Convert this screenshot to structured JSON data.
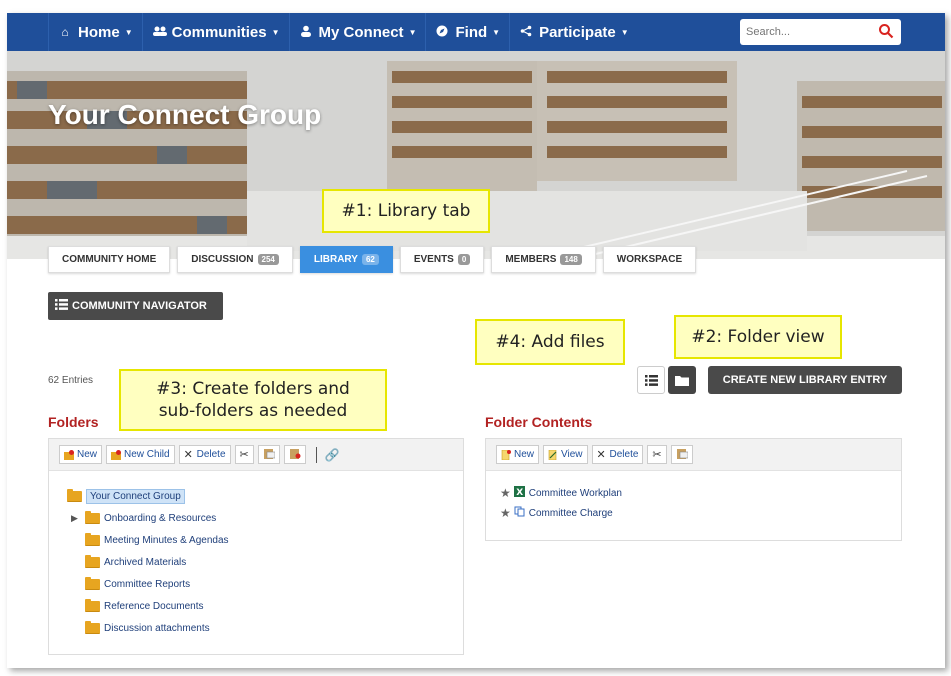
{
  "nav": {
    "items": [
      {
        "label": "Home",
        "icon": "home-icon"
      },
      {
        "label": "Communities",
        "icon": "people-icon"
      },
      {
        "label": "My Connect",
        "icon": "user-icon"
      },
      {
        "label": "Find",
        "icon": "compass-icon"
      },
      {
        "label": "Participate",
        "icon": "share-icon"
      }
    ],
    "search_placeholder": "Search..."
  },
  "banner": {
    "title": "Your Connect Group"
  },
  "tabs": [
    {
      "label": "COMMUNITY HOME",
      "count": null
    },
    {
      "label": "DISCUSSION",
      "count": "254"
    },
    {
      "label": "LIBRARY",
      "count": "62"
    },
    {
      "label": "EVENTS",
      "count": "0"
    },
    {
      "label": "MEMBERS",
      "count": "148"
    },
    {
      "label": "WORKSPACE",
      "count": null
    }
  ],
  "community_navigator": "COMMUNITY NAVIGATOR",
  "entries": "62 Entries",
  "create_button": "CREATE NEW LIBRARY ENTRY",
  "folders": {
    "heading": "Folders",
    "toolbar": {
      "new": "New",
      "new_child": "New Child",
      "delete": "Delete"
    },
    "tree": [
      {
        "label": "Your Connect Group",
        "level": 0,
        "selected": true,
        "expandable": false
      },
      {
        "label": "Onboarding & Resources",
        "level": 1,
        "selected": false,
        "expandable": true
      },
      {
        "label": "Meeting Minutes & Agendas",
        "level": 1,
        "selected": false,
        "expandable": false
      },
      {
        "label": "Archived Materials",
        "level": 1,
        "selected": false,
        "expandable": false
      },
      {
        "label": "Committee Reports",
        "level": 1,
        "selected": false,
        "expandable": false
      },
      {
        "label": "Reference Documents",
        "level": 1,
        "selected": false,
        "expandable": false
      },
      {
        "label": "Discussion attachments",
        "level": 1,
        "selected": false,
        "expandable": false
      }
    ]
  },
  "contents": {
    "heading": "Folder Contents",
    "toolbar": {
      "new": "New",
      "view": "View",
      "delete": "Delete"
    },
    "files": [
      {
        "label": "Committee Workplan",
        "icon": "excel-file-icon"
      },
      {
        "label": "Committee Charge",
        "icon": "link-file-icon"
      }
    ]
  },
  "callouts": {
    "library_tab": "#1: Library tab",
    "folder_view": "#2: Folder view",
    "create_folders_1": "#3: Create folders and",
    "create_folders_2": "sub-folders as needed",
    "add_files": "#4: Add files"
  },
  "colors": {
    "nav_bg": "#1f4f9a",
    "active_tab": "#3a8fe0",
    "section_heading": "#b22222",
    "callout_bg": "#ffffc0",
    "callout_border": "#e6e600"
  }
}
